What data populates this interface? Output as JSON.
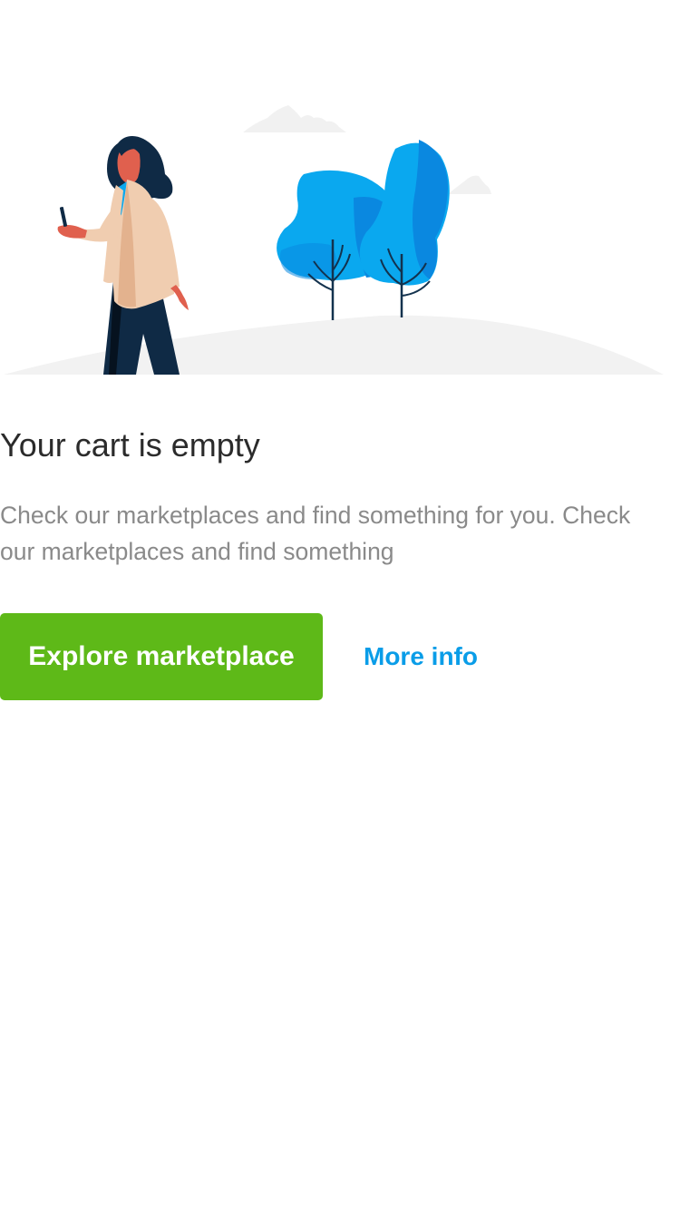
{
  "empty_state": {
    "illustration": "woman-walking-with-phone-near-trees",
    "title": "Your cart is empty",
    "description": "Check our marketplaces and find something for you. Check our marketplaces and find something",
    "primary_action_label": "Explore marketplace",
    "secondary_action_label": "More info"
  },
  "colors": {
    "primary_button": "#5eb918",
    "link": "#0a9de8",
    "title_text": "#2b2b2b",
    "body_text": "#8a8a8a",
    "tree_blue": "#0aa8ef",
    "tree_dark_blue": "#0a88e0",
    "ground": "#f2f2f2"
  }
}
